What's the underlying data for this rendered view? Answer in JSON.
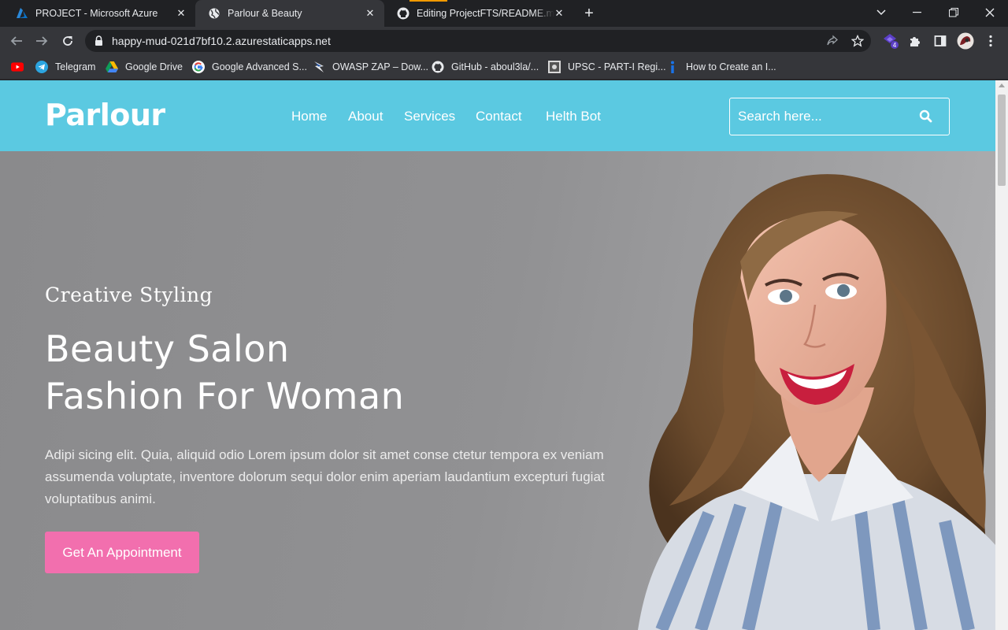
{
  "browser": {
    "tabs": [
      {
        "title": "PROJECT - Microsoft Azure",
        "icon": "azure-icon"
      },
      {
        "title": "Parlour & Beauty",
        "icon": "globe-icon",
        "active": true
      },
      {
        "title": "Editing ProjectFTS/README.md at",
        "icon": "github-icon"
      }
    ],
    "url": "happy-mud-021d7bf10.2.azurestaticapps.net",
    "extension_badge": "4",
    "bookmarks": [
      {
        "label": "",
        "icon": "youtube-icon"
      },
      {
        "label": "Telegram",
        "icon": "telegram-icon"
      },
      {
        "label": "Google Drive",
        "icon": "google-drive-icon"
      },
      {
        "label": "Google Advanced S...",
        "icon": "google-icon"
      },
      {
        "label": "OWASP ZAP – Dow...",
        "icon": "owasp-zap-icon"
      },
      {
        "label": "GitHub - aboul3la/...",
        "icon": "github-icon"
      },
      {
        "label": "UPSC - PART-I Regi...",
        "icon": "upsc-icon"
      },
      {
        "label": "How to Create an I...",
        "icon": "info-icon"
      }
    ]
  },
  "site": {
    "logo": "Parlour",
    "nav": [
      "Home",
      "About",
      "Services",
      "Contact",
      "Helth Bot"
    ],
    "search_placeholder": "Search here...",
    "hero": {
      "tagline": "Creative Styling",
      "headline_line1": "Beauty Salon",
      "headline_line2": "Fashion For Woman",
      "description": "Adipi sicing elit. Quia, aliquid odio Lorem ipsum dolor sit amet conse ctetur tempora ex veniam assumenda voluptate, inventore dolorum sequi dolor enim aperiam laudantium excepturi fugiat voluptatibus animi.",
      "cta": "Get An Appointment"
    }
  },
  "colors": {
    "header": "#5bc9e1",
    "cta": "#f26fae",
    "chrome_dark": "#202124",
    "chrome_toolbar": "#35363a"
  }
}
